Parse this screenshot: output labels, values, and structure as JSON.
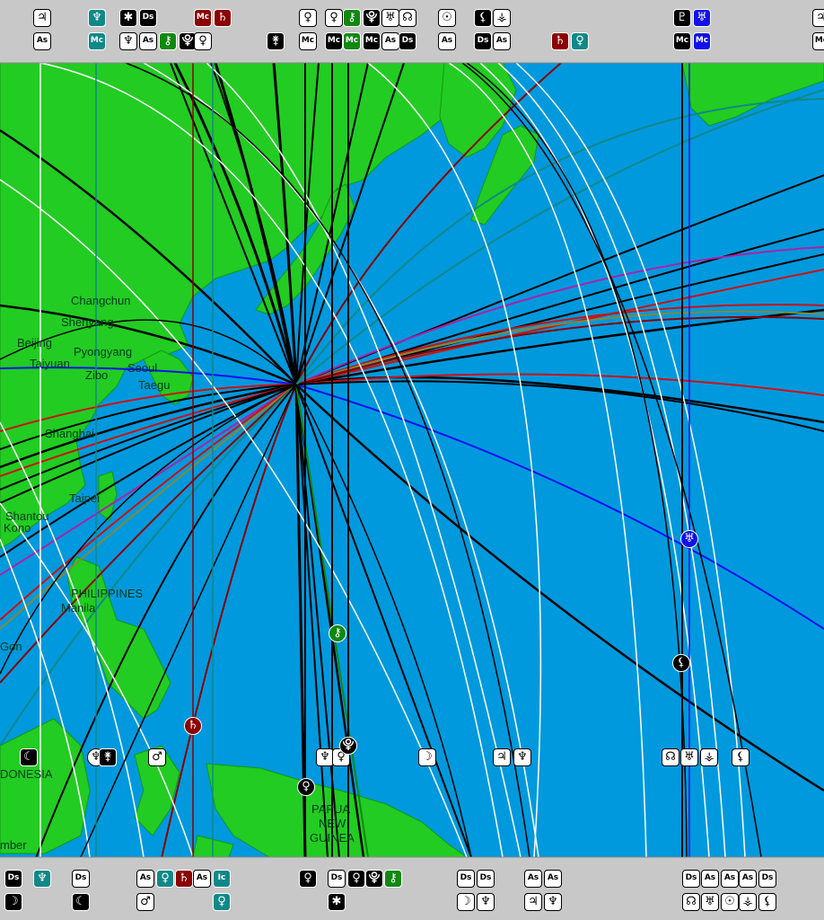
{
  "colors": {
    "ocean": "#0099dd",
    "land": "#22cc22",
    "band": "#c8c8c8",
    "white": "#ffffff",
    "black": "#000000",
    "red": "#cc1111",
    "darkred": "#8b0000",
    "blue": "#1111ee",
    "teal": "#118888",
    "olive": "#888833",
    "purple": "#aa22aa",
    "green": "#118811"
  },
  "cities": [
    {
      "name": "Changchun"
    },
    {
      "name": "Shenyang"
    },
    {
      "name": "Beijing"
    },
    {
      "name": "Pyongyang"
    },
    {
      "name": "Taiyuan"
    },
    {
      "name": "Seoul"
    },
    {
      "name": "Zibo"
    },
    {
      "name": "Taegu"
    },
    {
      "name": "Shanghai"
    },
    {
      "name": "Taipei"
    },
    {
      "name": "Shantou"
    },
    {
      "name": "Kono"
    },
    {
      "name": "Manila"
    },
    {
      "name": "Gon"
    },
    {
      "name": "mber"
    }
  ],
  "countries": [
    {
      "name": "PHILIPPINES"
    },
    {
      "name": "DONESIA"
    },
    {
      "name": "PAPUA"
    },
    {
      "name": "NEW"
    },
    {
      "name": "GUINEA"
    }
  ],
  "top_glyphs": [
    {
      "sym": "♃",
      "style": "light",
      "icon": "jupiter-icon"
    },
    {
      "sym": "As",
      "style": "light",
      "ang": true,
      "icon": "ascendant-icon"
    },
    {
      "sym": "♆",
      "style": "teal",
      "icon": "neptune-icon"
    },
    {
      "sym": "Mc",
      "style": "teal",
      "ang": true,
      "icon": "midheaven-icon"
    },
    {
      "sym": "✱",
      "style": "dark",
      "icon": "vesta-icon"
    },
    {
      "sym": "♆",
      "style": "light",
      "icon": "neptune-icon"
    },
    {
      "sym": "Ds",
      "style": "dark",
      "ang": true,
      "icon": "descendant-icon"
    },
    {
      "sym": "As",
      "style": "light",
      "ang": true,
      "icon": "ascendant-icon"
    },
    {
      "sym": "⚷",
      "style": "green",
      "icon": "chiron-icon"
    },
    {
      "sym": "⯓",
      "style": "dark",
      "icon": "pluto-icon"
    },
    {
      "sym": "Mc",
      "style": "red",
      "ang": true,
      "icon": "midheaven-icon"
    },
    {
      "sym": "♀",
      "style": "light",
      "icon": "venus-icon"
    },
    {
      "sym": "♄",
      "style": "red",
      "icon": "saturn-icon"
    },
    {
      "sym": "⚵",
      "style": "dark",
      "icon": "juno-icon"
    },
    {
      "sym": "♀",
      "style": "light",
      "icon": "venus-icon"
    },
    {
      "sym": "Mc",
      "style": "light",
      "ang": true,
      "icon": "midheaven-icon"
    },
    {
      "sym": "♀",
      "style": "light",
      "icon": "venus-icon"
    },
    {
      "sym": "Mc",
      "style": "dark",
      "ang": true,
      "icon": "midheaven-icon"
    },
    {
      "sym": "⚷",
      "style": "green",
      "icon": "chiron-icon"
    },
    {
      "sym": "Mc",
      "style": "green",
      "ang": true,
      "icon": "midheaven-icon"
    },
    {
      "sym": "⯓",
      "style": "dark",
      "icon": "pluto-icon"
    },
    {
      "sym": "Mc",
      "style": "dark",
      "ang": true,
      "icon": "midheaven-icon"
    },
    {
      "sym": "♅",
      "style": "light",
      "icon": "uranus-icon"
    },
    {
      "sym": "As",
      "style": "light",
      "ang": true,
      "icon": "ascendant-icon"
    },
    {
      "sym": "☊",
      "style": "light",
      "icon": "node-icon"
    },
    {
      "sym": "Ds",
      "style": "dark",
      "ang": true,
      "icon": "descendant-icon"
    },
    {
      "sym": "☉",
      "style": "light",
      "icon": "sun-icon"
    },
    {
      "sym": "As",
      "style": "light",
      "ang": true,
      "icon": "ascendant-icon"
    },
    {
      "sym": "⚸",
      "style": "dark",
      "icon": "lilith-icon"
    },
    {
      "sym": "Ds",
      "style": "dark",
      "ang": true,
      "icon": "descendant-icon"
    },
    {
      "sym": "⚶",
      "style": "light",
      "icon": "vertex-icon"
    },
    {
      "sym": "As",
      "style": "light",
      "ang": true,
      "icon": "ascendant-icon"
    },
    {
      "sym": "♄",
      "style": "red",
      "icon": "saturn-icon"
    },
    {
      "sym": "♀",
      "style": "teal",
      "icon": "venus-icon"
    },
    {
      "sym": "♇",
      "style": "dark",
      "icon": "pluto-icon"
    },
    {
      "sym": "Mc",
      "style": "dark",
      "ang": true,
      "icon": "midheaven-icon"
    },
    {
      "sym": "♅",
      "style": "blue",
      "icon": "uranus-icon"
    },
    {
      "sym": "Mc",
      "style": "blue",
      "ang": true,
      "icon": "midheaven-icon"
    },
    {
      "sym": "♃",
      "style": "light",
      "icon": "jupiter-icon"
    },
    {
      "sym": "Mc",
      "style": "light",
      "ang": true,
      "icon": "midheaven-icon"
    }
  ],
  "bottom_glyphs": [
    {
      "sym": "Ds",
      "style": "dark",
      "ang": true,
      "icon": "descendant-icon"
    },
    {
      "sym": "☽",
      "style": "dark",
      "icon": "moon-icon"
    },
    {
      "sym": "♆",
      "style": "teal",
      "icon": "neptune-icon"
    },
    {
      "sym": "Ds",
      "style": "light",
      "ang": true,
      "icon": "descendant-icon"
    },
    {
      "sym": "☾",
      "style": "dark",
      "icon": "moon-icon"
    },
    {
      "sym": "As",
      "style": "light",
      "ang": true,
      "icon": "ascendant-icon"
    },
    {
      "sym": "♀",
      "style": "teal",
      "icon": "venus-icon"
    },
    {
      "sym": "♄",
      "style": "red",
      "icon": "saturn-icon"
    },
    {
      "sym": "As",
      "style": "light",
      "ang": true,
      "icon": "ascendant-icon"
    },
    {
      "sym": "Ic",
      "style": "teal",
      "ang": true,
      "icon": "imum-coeli-icon"
    },
    {
      "sym": "♂",
      "style": "light",
      "icon": "mars-icon"
    },
    {
      "sym": "♀",
      "style": "teal",
      "icon": "venus-icon"
    },
    {
      "sym": "♀",
      "style": "dark",
      "icon": "venus-icon"
    },
    {
      "sym": "Ds",
      "style": "light",
      "ang": true,
      "icon": "descendant-icon"
    },
    {
      "sym": "✱",
      "style": "dark",
      "icon": "vesta-icon"
    },
    {
      "sym": "♀",
      "style": "dark",
      "icon": "venus-icon"
    },
    {
      "sym": "⯓",
      "style": "dark",
      "icon": "pluto-icon"
    },
    {
      "sym": "⚷",
      "style": "green",
      "icon": "chiron-icon"
    },
    {
      "sym": "Ds",
      "style": "light",
      "ang": true,
      "icon": "descendant-icon"
    },
    {
      "sym": "Ds",
      "style": "light",
      "ang": true,
      "icon": "descendant-icon"
    },
    {
      "sym": "☽",
      "style": "light",
      "icon": "moon-icon"
    },
    {
      "sym": "♆",
      "style": "light",
      "icon": "neptune-icon"
    },
    {
      "sym": "As",
      "style": "light",
      "ang": true,
      "icon": "ascendant-icon"
    },
    {
      "sym": "As",
      "style": "light",
      "ang": true,
      "icon": "ascendant-icon"
    },
    {
      "sym": "♃",
      "style": "light",
      "icon": "jupiter-icon"
    },
    {
      "sym": "♆",
      "style": "light",
      "icon": "neptune-icon"
    },
    {
      "sym": "Ds",
      "style": "light",
      "ang": true,
      "icon": "descendant-icon"
    },
    {
      "sym": "As",
      "style": "light",
      "ang": true,
      "icon": "ascendant-icon"
    },
    {
      "sym": "As",
      "style": "light",
      "ang": true,
      "icon": "ascendant-icon"
    },
    {
      "sym": "As",
      "style": "light",
      "ang": true,
      "icon": "ascendant-icon"
    },
    {
      "sym": "Ds",
      "style": "light",
      "ang": true,
      "icon": "descendant-icon"
    },
    {
      "sym": "☊",
      "style": "light",
      "icon": "node-icon"
    },
    {
      "sym": "♅",
      "style": "light",
      "icon": "uranus-icon"
    },
    {
      "sym": "☉",
      "style": "light",
      "icon": "sun-icon"
    },
    {
      "sym": "⚶",
      "style": "light",
      "icon": "vertex-icon"
    },
    {
      "sym": "⚸",
      "style": "light",
      "icon": "lilith-icon"
    }
  ],
  "map_glyphs": [
    {
      "sym": "☾",
      "style": "dark",
      "icon": "moon-icon"
    },
    {
      "sym": "♆",
      "style": "light",
      "icon": "neptune-icon"
    },
    {
      "sym": "♂",
      "style": "light",
      "icon": "mars-icon"
    },
    {
      "sym": "♄",
      "style": "red",
      "icon": "saturn-icon"
    },
    {
      "sym": "♆",
      "style": "light",
      "icon": "neptune-icon"
    },
    {
      "sym": "♀",
      "style": "light",
      "icon": "venus-icon"
    },
    {
      "sym": "⯓",
      "style": "dark",
      "icon": "pluto-icon"
    },
    {
      "sym": "☽",
      "style": "light",
      "icon": "moon-icon"
    },
    {
      "sym": "♃",
      "style": "light",
      "icon": "jupiter-icon"
    },
    {
      "sym": "♆",
      "style": "light",
      "icon": "neptune-icon"
    },
    {
      "sym": "☊",
      "style": "light",
      "icon": "node-icon"
    },
    {
      "sym": "♅",
      "style": "light",
      "icon": "uranus-icon"
    },
    {
      "sym": "☉",
      "style": "light",
      "icon": "sun-icon"
    },
    {
      "sym": "⚶",
      "style": "light",
      "icon": "vertex-icon"
    },
    {
      "sym": "⚸",
      "style": "light",
      "icon": "lilith-icon"
    },
    {
      "sym": "♀",
      "style": "dark",
      "icon": "venus-icon"
    },
    {
      "sym": "⚷",
      "style": "green",
      "icon": "chiron-icon"
    },
    {
      "sym": "♅",
      "style": "blue",
      "icon": "uranus-icon"
    },
    {
      "sym": "⚸",
      "style": "dark",
      "icon": "lilith-icon"
    },
    {
      "sym": "✶",
      "style": "dark",
      "icon": "vesta-icon"
    },
    {
      "sym": "⚵",
      "style": "dark",
      "icon": "juno-icon"
    }
  ]
}
